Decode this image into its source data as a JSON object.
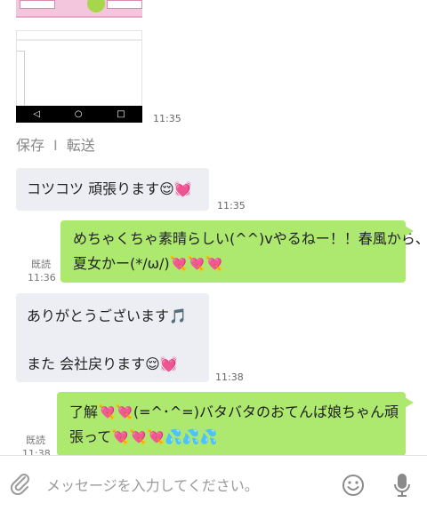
{
  "images": {
    "screenshot_time": "11:35"
  },
  "actions": {
    "save": "保存",
    "separator": "I",
    "forward": "転送"
  },
  "messages": [
    {
      "direction": "incoming",
      "lines": [
        "コツコツ 頑張ります😌💓"
      ],
      "time": "11:35"
    },
    {
      "direction": "outgoing",
      "lines": [
        "めちゃくちゃ素晴らしい(^^)vやるねー！！春風から、",
        "夏女かー(*/ω/)💘💘💘"
      ],
      "read": "既読",
      "time": "11:36"
    },
    {
      "direction": "incoming",
      "lines": [
        "ありがとうございます🎵",
        "",
        "また  会社戻ります😌💓"
      ],
      "time": "11:38"
    },
    {
      "direction": "outgoing",
      "lines": [
        "了解💘💘(=^･^=)バタバタのおてんば娘ちゃん頑",
        "張って💘💘💘💦💦💦"
      ],
      "read": "既読",
      "time": "11:38"
    }
  ],
  "input": {
    "placeholder": "メッセージを入力してください。"
  },
  "icons": {
    "attach": "paperclip-icon",
    "emoji": "smiley-icon",
    "voice": "microphone-icon"
  },
  "colors": {
    "outgoing_bubble": "#ade86f",
    "incoming_bubble": "#eceef3"
  }
}
